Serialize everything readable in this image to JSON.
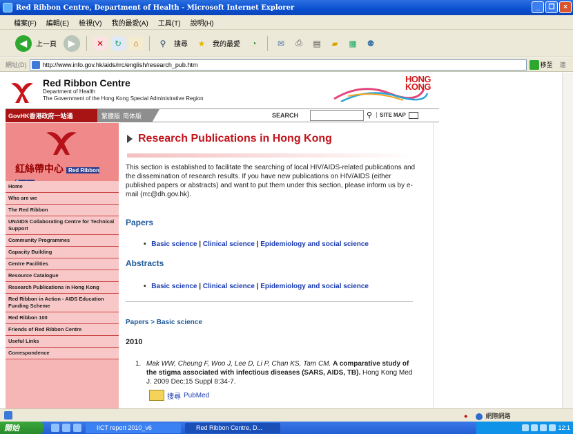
{
  "window": {
    "title": "Red Ribbon Centre, Department of Health - Microsoft Internet Explorer",
    "controls": [
      "_",
      "❐",
      "×"
    ]
  },
  "menu": [
    "檔案(F)",
    "編輯(E)",
    "檢視(V)",
    "我的最愛(A)",
    "工具(T)",
    "說明(H)"
  ],
  "toolbar": {
    "back_label": "上一頁",
    "search_label": "搜尋",
    "favorites_label": "我的最愛"
  },
  "address": {
    "label": "網址(D)",
    "url": "http://www.info.gov.hk/aids/rrc/english/research_pub.htm",
    "go_label": "移至",
    "links_label": "連"
  },
  "site": {
    "name": "Red Ribbon Centre",
    "dept": "Department of Health",
    "govt": "The Government of the Hong Kong Special Administrative Region",
    "hk_brand_line1": "HONG",
    "hk_brand_line2": "KONG",
    "govhk": "GovHK香港政府一站通",
    "lang_trad": "繁體版",
    "lang_simp": "简体版",
    "search_label": "SEARCH",
    "sitemap_label": "SITE MAP"
  },
  "sidebar": {
    "logo_text": "紅絲帶中心",
    "logo_badge": "Red Ribbon Centre",
    "items": [
      "Home",
      "Who are we",
      "The Red Ribbon",
      "UNAIDS Collaborating Centre for Technical Support",
      "Community Programmes",
      "Capacity Building",
      "Centre Facilities",
      "Resource Catalogue",
      "Research Publications in Hong Kong",
      "Red Ribbon in Action - AIDS Education Funding Scheme",
      "Red Ribbon 100",
      "Friends of Red Ribbon Centre",
      "Useful Links",
      "Correspondence"
    ]
  },
  "main": {
    "title": "Research Publications in Hong Kong",
    "intro": "This section is established to facilitate the searching of local HIV/AIDS-related publications and the dissemination of research results. If you have new publications on HIV/AIDS (either published papers or abstracts) and want to put them under this section, please inform us by e-mail (rrc@dh.gov.hk).",
    "papers_title": "Papers",
    "abstracts_title": "Abstracts",
    "links": [
      "Basic science",
      "Clinical science",
      "Epidemiology and social science"
    ],
    "separator": "|",
    "breadcrumb": "Papers > Basic science",
    "year": "2010",
    "ref_num": "1.",
    "ref_authors": "Mak WW, Cheung F, Woo J, Lee D, Li P, Chan KS, Tam CM.",
    "ref_title": "A comparative study of the stigma associated with infectious diseases (SARS, AIDS, TB).",
    "ref_source": "Hong Kong Med J. 2009 Dec;15 Suppl 8:34-7.",
    "pubmed_prefix": "搜尋",
    "pubmed_label": "PubMed"
  },
  "status": {
    "zone": "網際網路"
  },
  "taskbar": {
    "start": "開始",
    "task1": "IICT report 2010_v6",
    "task2": "Red Ribbon Centre, D...",
    "clock": "12:1"
  }
}
